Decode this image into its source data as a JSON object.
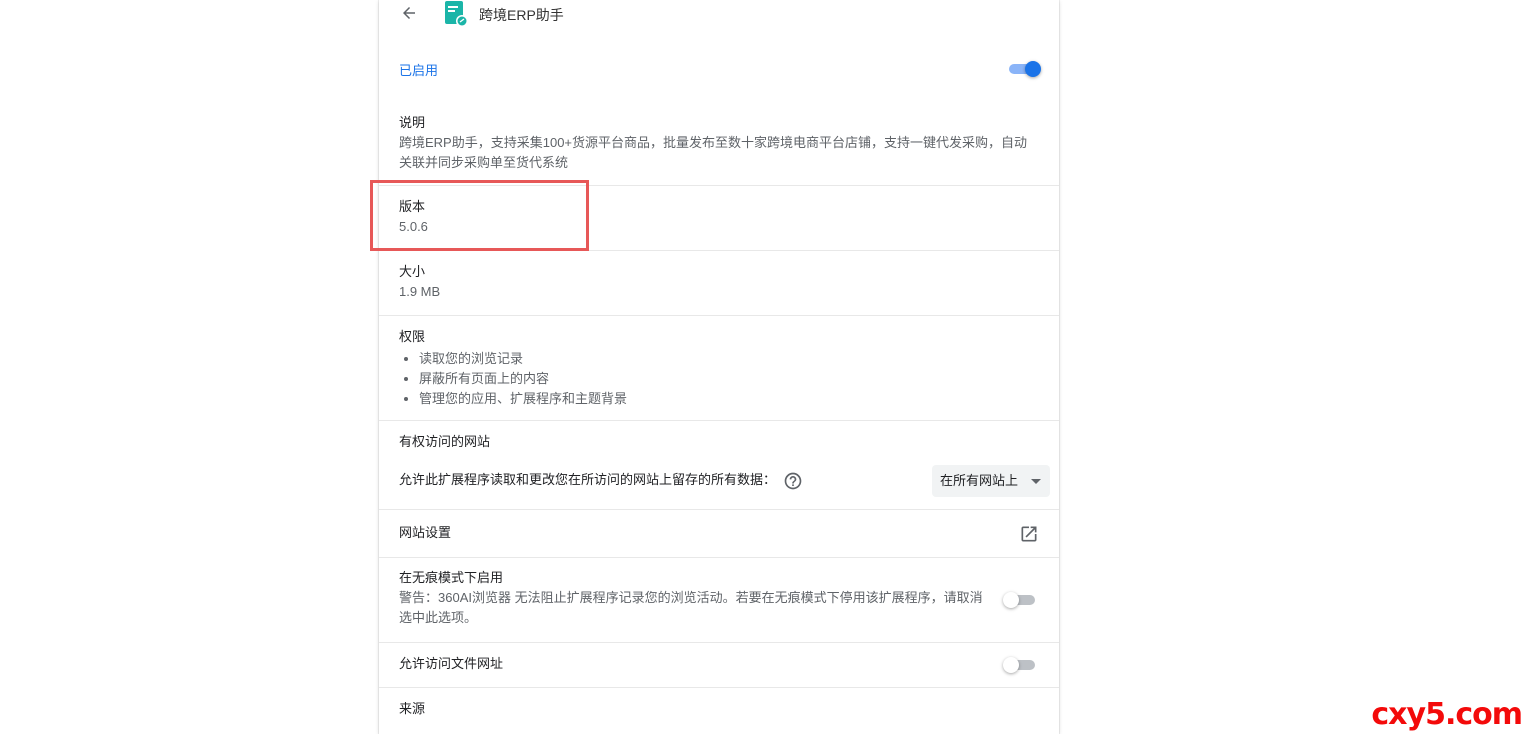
{
  "extension": {
    "name": "跨境ERP助手",
    "icon": "document-icon",
    "brand_color": "#1bb5a8"
  },
  "enabled": {
    "label": "已启用",
    "state": true
  },
  "description": {
    "label": "说明",
    "text": "跨境ERP助手，支持采集100+货源平台商品，批量发布至数十家跨境电商平台店铺，支持一键代发采购，自动关联并同步采购单至货代系统"
  },
  "version": {
    "label": "版本",
    "value": "5.0.6"
  },
  "size": {
    "label": "大小",
    "value": "1.9 MB"
  },
  "permissions": {
    "label": "权限",
    "items": [
      "读取您的浏览记录",
      "屏蔽所有页面上的内容",
      "管理您的应用、扩展程序和主题背景"
    ]
  },
  "site_access": {
    "title": "有权访问的网站",
    "description": "允许此扩展程序读取和更改您在所访问的网站上留存的所有数据：",
    "selected_option": "在所有网站上"
  },
  "site_settings": {
    "label": "网站设置"
  },
  "incognito": {
    "label": "在无痕模式下启用",
    "warning": "警告：360AI浏览器 无法阻止扩展程序记录您的浏览活动。若要在无痕模式下停用该扩展程序，请取消选中此选项。",
    "state": false
  },
  "file_urls": {
    "label": "允许访问文件网址",
    "state": false
  },
  "source": {
    "label": "来源"
  },
  "watermark": "cxy5.com",
  "colors": {
    "accent": "#1a73e8",
    "highlight": "#e75858",
    "watermark": "#f30a0a"
  }
}
